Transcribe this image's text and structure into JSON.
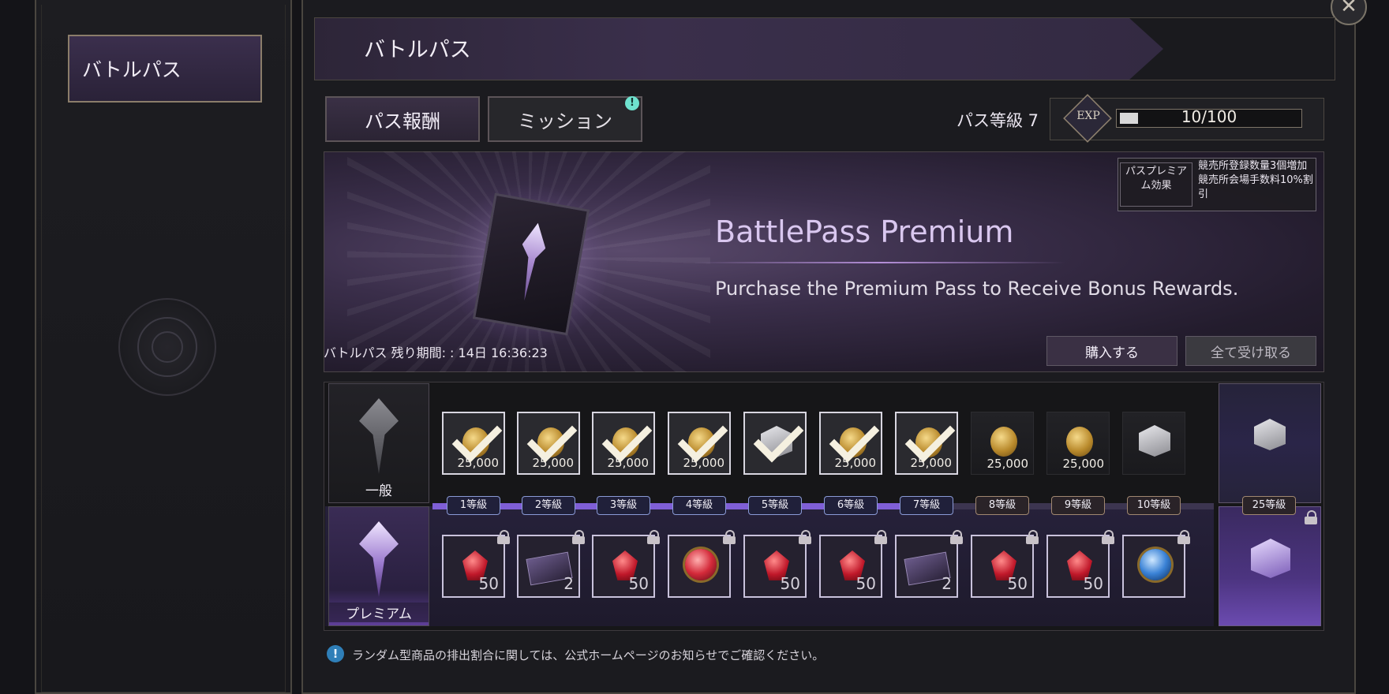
{
  "sidebar": {
    "items": [
      {
        "label": "バトルパス"
      }
    ]
  },
  "header": {
    "title": "バトルパス",
    "close_icon": "close-icon"
  },
  "tabs": [
    {
      "label": "パス報酬"
    },
    {
      "label": "ミッション",
      "badge": "!"
    }
  ],
  "pass": {
    "level_label": "パス等級 7",
    "exp_badge": "EXP",
    "exp_value": "10/100",
    "exp_fraction": 0.1
  },
  "banner": {
    "title": "BattlePass Premium",
    "subtitle": "Purchase the Premium Pass to Receive Bonus Rewards.",
    "remaining": "バトルパス 残り期間: : 14日 16:36:23",
    "buy_button": "購入する",
    "claim_all_button": "全て受け取る",
    "premium_effect_label": "パスプレミアム効果",
    "premium_effect_text": "競売所登録数量3個増加\n競売所会場手数料10%割引"
  },
  "track": {
    "normal_label": "一般",
    "premium_label": "プレミアム",
    "tiers": [
      "1等級",
      "2等級",
      "3等級",
      "4等級",
      "5等級",
      "6等級",
      "7等級",
      "8等級",
      "9等級",
      "10等級"
    ],
    "final_tier": "25等級",
    "normal_rewards": [
      {
        "icon": "gold-coin-icon",
        "qty": "25,000",
        "claimed": true
      },
      {
        "icon": "gold-coin-icon",
        "qty": "25,000",
        "claimed": true
      },
      {
        "icon": "gold-coin-icon",
        "qty": "25,000",
        "claimed": true
      },
      {
        "icon": "gold-coin-icon",
        "qty": "25,000",
        "claimed": true
      },
      {
        "icon": "box-icon",
        "qty": "",
        "claimed": true
      },
      {
        "icon": "gold-coin-icon",
        "qty": "25,000",
        "claimed": true
      },
      {
        "icon": "gold-coin-icon",
        "qty": "25,000",
        "claimed": true
      },
      {
        "icon": "gold-coin-icon",
        "qty": "25,000",
        "claimed": false
      },
      {
        "icon": "gold-coin-icon",
        "qty": "25,000",
        "claimed": false
      },
      {
        "icon": "box-icon",
        "qty": "",
        "claimed": false
      }
    ],
    "premium_rewards": [
      {
        "icon": "red-gem-icon",
        "qty": "50"
      },
      {
        "icon": "ticket-icon",
        "qty": "2"
      },
      {
        "icon": "red-gem-icon",
        "qty": "50"
      },
      {
        "icon": "red-orb-icon",
        "qty": ""
      },
      {
        "icon": "red-gem-icon",
        "qty": "50"
      },
      {
        "icon": "red-gem-icon",
        "qty": "50"
      },
      {
        "icon": "ticket-icon",
        "qty": "2"
      },
      {
        "icon": "red-gem-icon",
        "qty": "50"
      },
      {
        "icon": "red-gem-icon",
        "qty": "50"
      },
      {
        "icon": "blue-orb-icon",
        "qty": ""
      }
    ]
  },
  "notice": "ランダム型商品の排出割合に関しては、公式ホームページのお知らせでご確認ください。",
  "colors": {
    "accent": "#7f5fd6",
    "panel": "#1b1b1f",
    "border": "#4a4640"
  }
}
